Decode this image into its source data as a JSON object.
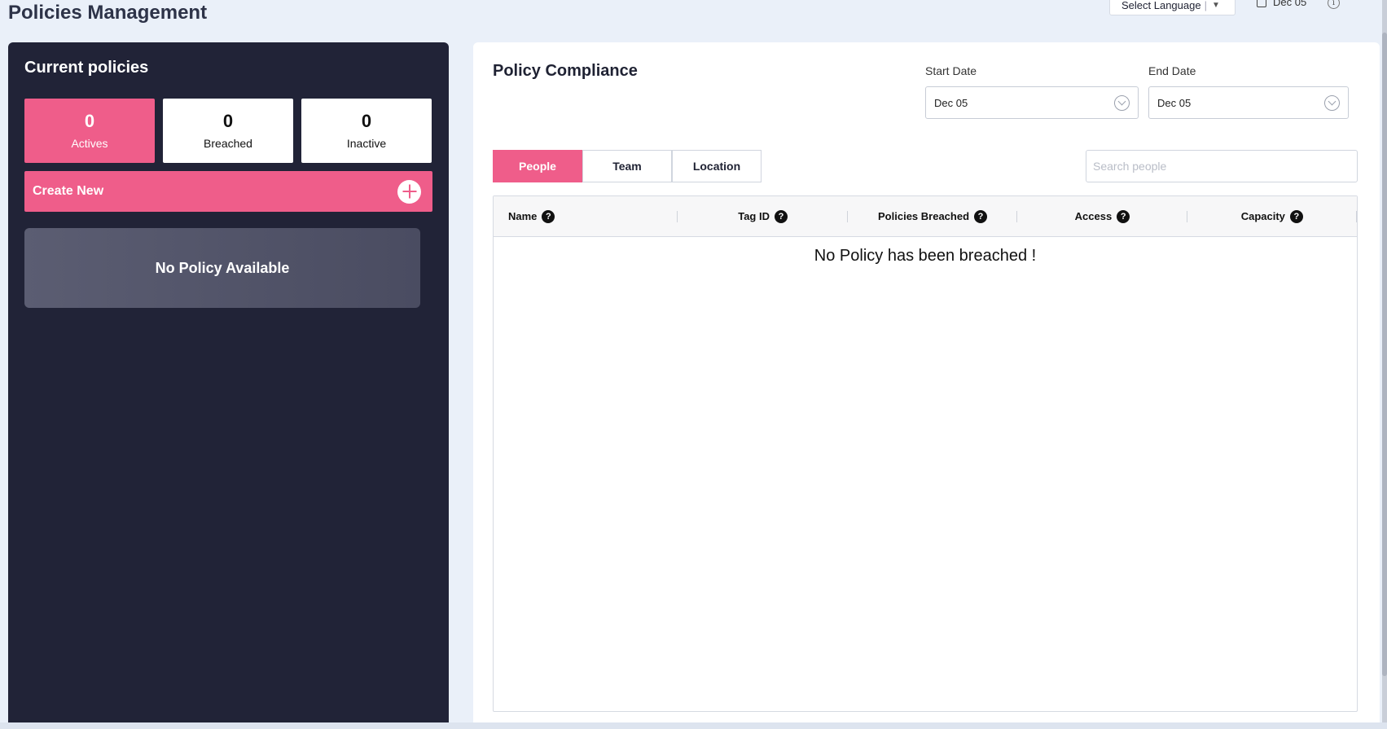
{
  "header": {
    "title": "Policies Management",
    "language_select": "Select Language",
    "date": "Dec 05"
  },
  "current_policies": {
    "title": "Current policies",
    "stats": [
      {
        "value": "0",
        "label": "Actives"
      },
      {
        "value": "0",
        "label": "Breached"
      },
      {
        "value": "0",
        "label": "Inactive"
      }
    ],
    "create_new_label": "Create New",
    "empty_message": "No Policy Available"
  },
  "compliance": {
    "title": "Policy Compliance",
    "start_date_label": "Start Date",
    "start_date_value": "Dec 05",
    "end_date_label": "End Date",
    "end_date_value": "Dec 05",
    "tabs": [
      "People",
      "Team",
      "Location"
    ],
    "active_tab": "People",
    "search_placeholder": "Search people",
    "columns": [
      "Name",
      "Tag ID",
      "Policies Breached",
      "Access",
      "Capacity"
    ],
    "empty_message": "No Policy has been breached !"
  },
  "colors": {
    "accent": "#ef5d8a",
    "panel_dark": "#212337",
    "background": "#eaf0f9"
  }
}
